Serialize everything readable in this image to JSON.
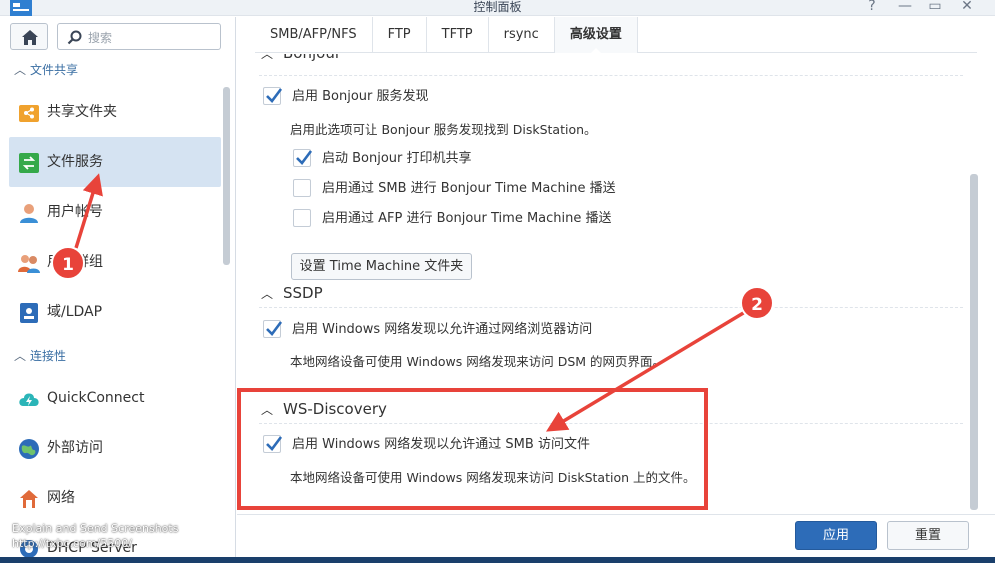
{
  "window": {
    "title": "控制面板",
    "controls": {
      "help": "?",
      "minimize": "—",
      "maximize": "▭",
      "close": "✕"
    }
  },
  "sidebar": {
    "search_placeholder": "搜索",
    "section_file_sharing": "文件共享",
    "section_connectivity": "连接性",
    "items": [
      {
        "label": "共享文件夹",
        "icon": "shared-folder-icon"
      },
      {
        "label": "文件服务",
        "icon": "file-services-icon",
        "active": true
      },
      {
        "label": "用户帐号",
        "icon": "user-icon"
      },
      {
        "label": "用户群组",
        "icon": "group-icon"
      },
      {
        "label": "域/LDAP",
        "icon": "domain-ldap-icon"
      },
      {
        "label": "QuickConnect",
        "icon": "quickconnect-icon"
      },
      {
        "label": "外部访问",
        "icon": "external-access-icon"
      },
      {
        "label": "网络",
        "icon": "network-icon"
      },
      {
        "label": "DHCP Server",
        "icon": "dhcp-server-icon"
      }
    ],
    "watermark_line1": "Explain and Send Screenshots",
    "watermark_line2": "http://txbc.com/5500/"
  },
  "tabs": [
    {
      "label": "SMB/AFP/NFS"
    },
    {
      "label": "FTP"
    },
    {
      "label": "TFTP"
    },
    {
      "label": "rsync"
    },
    {
      "label": "高级设置",
      "active": true
    }
  ],
  "bonjour": {
    "title": "Bonjour",
    "enable_label": "启用 Bonjour 服务发现",
    "enable_checked": true,
    "enable_desc": "启用此选项可让 Bonjour 服务发现找到 DiskStation。",
    "printer_label": "启动 Bonjour 打印机共享",
    "printer_checked": true,
    "smb_tm_label": "启用通过 SMB 进行 Bonjour Time Machine 播送",
    "smb_tm_checked": false,
    "afp_tm_label": "启用通过 AFP 进行 Bonjour Time Machine 播送",
    "afp_tm_checked": false,
    "tm_folder_button": "设置 Time Machine 文件夹"
  },
  "ssdp": {
    "title": "SSDP",
    "enable_label": "启用 Windows 网络发现以允许通过网络浏览器访问",
    "enable_checked": true,
    "desc": "本地网络设备可使用 Windows 网络发现来访问 DSM 的网页界面。"
  },
  "ws_discovery": {
    "title": "WS-Discovery",
    "enable_label": "启用 Windows 网络发现以允许通过 SMB 访问文件",
    "enable_checked": true,
    "desc": "本地网络设备可使用 Windows 网络发现来访问 DiskStation 上的文件。"
  },
  "footer": {
    "apply": "应用",
    "reset": "重置"
  },
  "annotations": {
    "badge1": "1",
    "badge2": "2",
    "color": "#e8433a"
  }
}
